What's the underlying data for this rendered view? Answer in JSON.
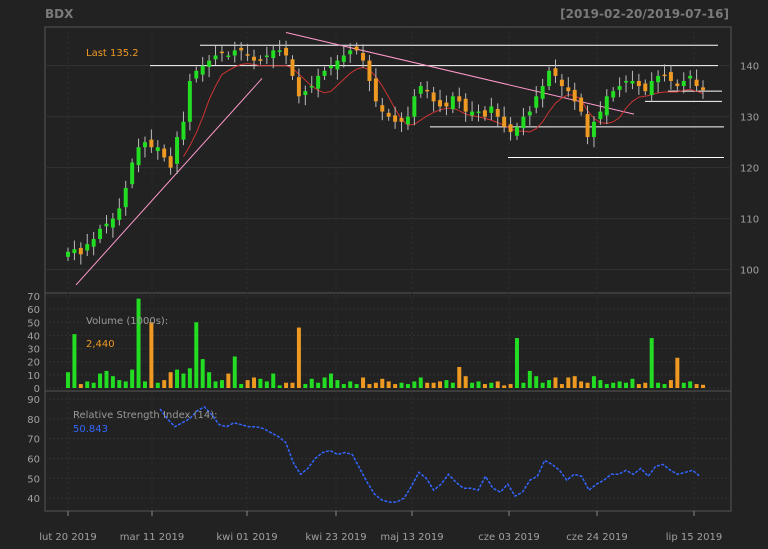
{
  "chart_data": {
    "type": "candlestick",
    "symbol": "BDX",
    "date_range": "[2019-02-20/2019-07-16]",
    "x_ticks": [
      "lut 20 2019",
      "mar 11 2019",
      "kwi 01 2019",
      "kwi 23 2019",
      "maj 13 2019",
      "cze 03 2019",
      "cze 24 2019",
      "lip 15 2019"
    ],
    "colors": {
      "up": "#22dd22",
      "down": "#ee9922",
      "rsi": "#3366ff",
      "ma": "#cc3333",
      "trend": "#ff99cc",
      "level": "#ffffff"
    },
    "price_panel": {
      "last_label": "Last 135.2",
      "ylim": [
        96,
        147
      ],
      "y_ticks": [
        100,
        110,
        120,
        130,
        140
      ],
      "horizontal_levels": [
        144,
        140,
        135,
        133,
        128,
        122
      ],
      "candles_close": [
        103.5,
        104,
        103,
        105,
        106,
        108,
        109,
        110,
        112,
        116,
        121,
        124,
        125,
        124,
        124,
        122,
        120,
        126,
        129,
        137,
        139,
        140,
        141,
        142,
        142.5,
        142,
        143,
        143,
        142,
        141,
        141,
        142,
        143,
        143,
        142,
        138,
        134,
        135,
        136,
        138,
        139,
        140,
        141,
        142,
        143,
        143,
        141,
        137,
        133,
        131,
        130,
        129,
        129,
        130,
        134,
        136,
        135,
        133,
        132,
        132,
        134,
        133,
        131,
        131,
        131,
        130,
        132,
        130,
        128,
        127,
        128,
        130,
        131,
        134,
        136,
        139,
        138,
        136,
        135,
        133,
        131,
        126,
        129,
        131,
        134,
        135,
        136,
        137,
        137,
        136,
        135,
        137,
        138,
        138,
        137,
        136,
        137,
        138,
        136,
        135.2
      ]
    },
    "volume_panel": {
      "label": "Volume (1000s):",
      "value_label": "2,440",
      "ylim": [
        0,
        70
      ],
      "y_ticks": [
        0,
        10,
        20,
        30,
        40,
        50,
        60,
        70
      ],
      "values": [
        12,
        41,
        3,
        5,
        4,
        11,
        13,
        9,
        6,
        5,
        14,
        68,
        5,
        50,
        4,
        6,
        12,
        14,
        11,
        15,
        50,
        22,
        12,
        5,
        6,
        11,
        24,
        3,
        6,
        8,
        7,
        5,
        11,
        2,
        4,
        4,
        46,
        3,
        7,
        4,
        8,
        11,
        6,
        3,
        5,
        3,
        8,
        3,
        4,
        7,
        5,
        3,
        4,
        3,
        5,
        8,
        4,
        4,
        5,
        6,
        4,
        16,
        9,
        4,
        5,
        3,
        4,
        5,
        2,
        3,
        38,
        4,
        13,
        9,
        4,
        6,
        8,
        3,
        8,
        9,
        5,
        4,
        9,
        6,
        3,
        4,
        5,
        4,
        7,
        3,
        4,
        38,
        4,
        3,
        6,
        23,
        4,
        5,
        3,
        2.44
      ]
    },
    "rsi_panel": {
      "label": "Relative Strength Index (14):",
      "value_label": "50.843",
      "ylim": [
        35,
        92
      ],
      "y_ticks": [
        40,
        50,
        60,
        70,
        80,
        90
      ],
      "values": [
        85,
        80,
        76,
        78,
        80,
        84,
        86,
        82,
        77,
        76,
        78,
        77,
        76,
        76,
        75,
        73,
        71,
        68,
        58,
        52,
        55,
        60,
        63,
        64,
        62,
        63,
        62,
        55,
        48,
        42,
        39,
        38,
        38,
        40,
        46,
        53,
        50,
        44,
        47,
        52,
        48,
        45,
        45,
        44,
        51,
        45,
        43,
        47,
        41,
        43,
        49,
        51,
        59,
        57,
        54,
        49,
        52,
        51,
        44,
        47,
        49,
        52,
        52,
        54,
        52,
        55,
        51,
        56,
        57,
        54,
        52,
        53,
        54,
        51
      ]
    }
  }
}
